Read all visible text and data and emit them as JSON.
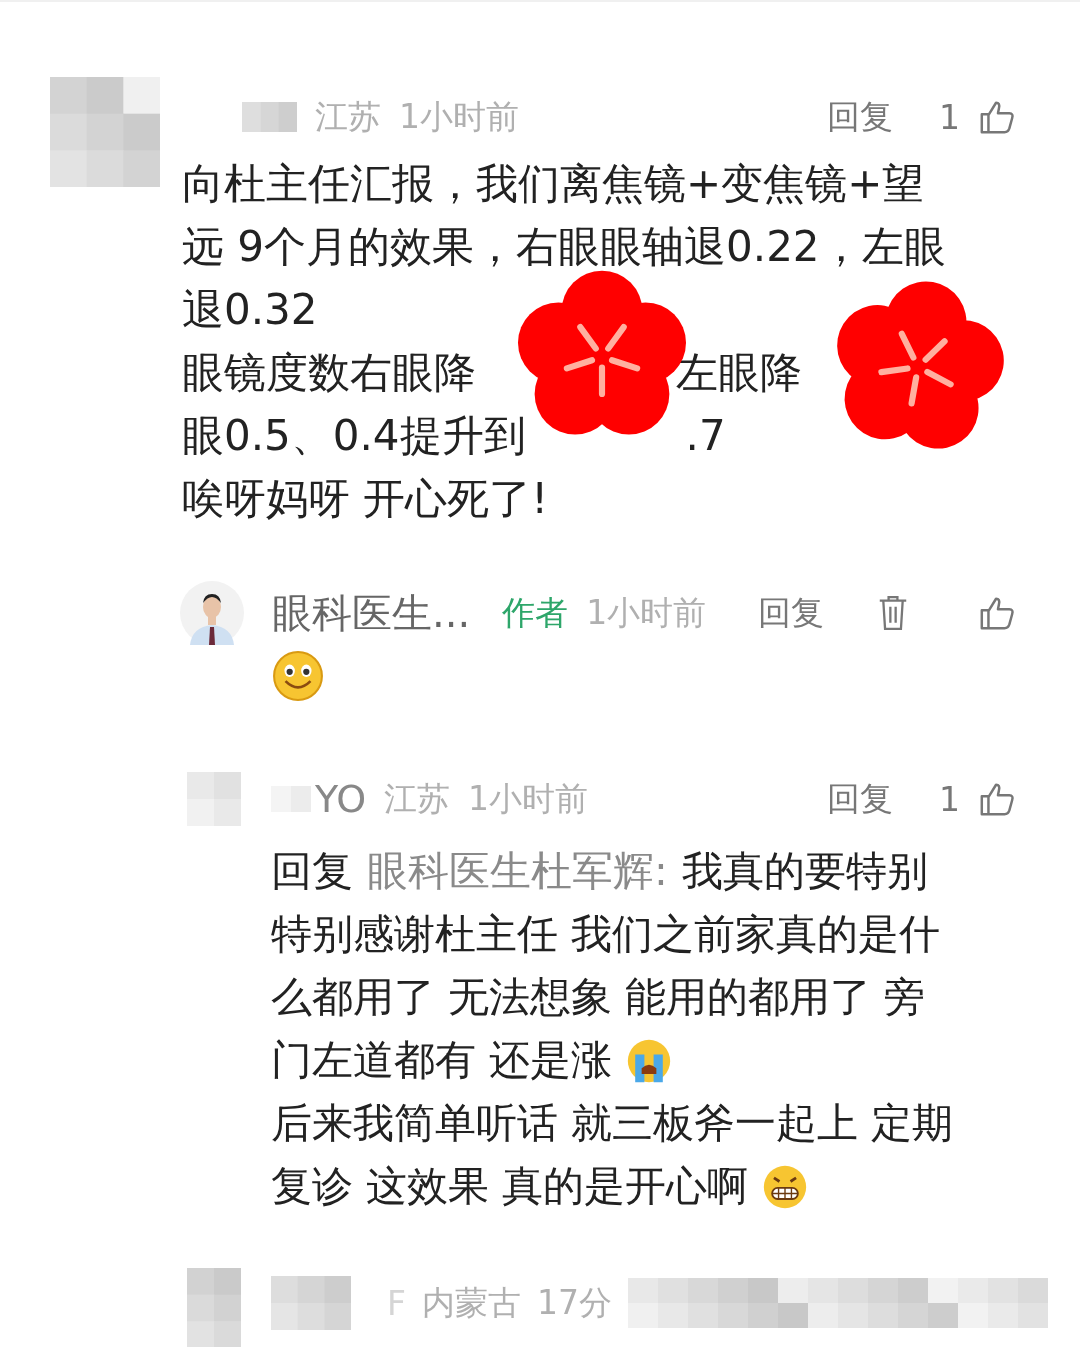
{
  "comments": [
    {
      "kind": "comment",
      "location": "江苏",
      "time": "1小时前",
      "reply_label": "回复",
      "like_count": "1",
      "lines": [
        [
          {
            "kind": "text",
            "text": "向杜主任汇报，我们离焦镜+变焦镜+望"
          }
        ],
        [
          {
            "kind": "text",
            "text": "远 9个月的效果，右眼眼轴退0.22，左眼"
          }
        ],
        [
          {
            "kind": "text",
            "text": "退0.32"
          }
        ],
        [
          {
            "kind": "text",
            "text": "眼镜度数右眼降"
          },
          {
            "kind": "text",
            "text": "左眼降"
          }
        ],
        [
          {
            "kind": "text",
            "text": "眼0.5、0.4提升到"
          },
          {
            "kind": "text",
            "text": ".7"
          }
        ],
        [
          {
            "kind": "text",
            "text": "唉呀妈呀 开心死了!"
          }
        ]
      ],
      "stickers": [
        {
          "kind": "flower"
        },
        {
          "kind": "flower"
        }
      ]
    },
    {
      "kind": "author_reply",
      "name": "眼科医生...",
      "badge": "作者",
      "time": "1小时前",
      "reply_label": "回复",
      "lines": [
        [
          {
            "kind": "smile"
          }
        ]
      ]
    },
    {
      "kind": "reply",
      "name": "YO",
      "location": "江苏",
      "time": "1小时前",
      "reply_label": "回复",
      "like_count": "1",
      "lines": [
        [
          {
            "kind": "text",
            "text": "回复"
          },
          {
            "kind": "mention",
            "text": "眼科医生杜军辉:"
          },
          {
            "kind": "text",
            "text": "我真的要特别"
          }
        ],
        [
          {
            "kind": "text",
            "text": "特别感谢杜主任 我们之前家真的是什"
          }
        ],
        [
          {
            "kind": "text",
            "text": "么都用了 无法想象 能用的都用了 旁"
          }
        ],
        [
          {
            "kind": "text",
            "text": "门左道都有 还是涨"
          },
          {
            "kind": "cry"
          }
        ],
        [
          {
            "kind": "text",
            "text": "后来我简单听话 就三板斧一起上 定期"
          }
        ],
        [
          {
            "kind": "text",
            "text": "复诊 这效果 真的是开心啊"
          },
          {
            "kind": "grin"
          }
        ]
      ]
    },
    {
      "kind": "partial",
      "name": "F",
      "location": "内蒙古",
      "time": "17分"
    }
  ]
}
